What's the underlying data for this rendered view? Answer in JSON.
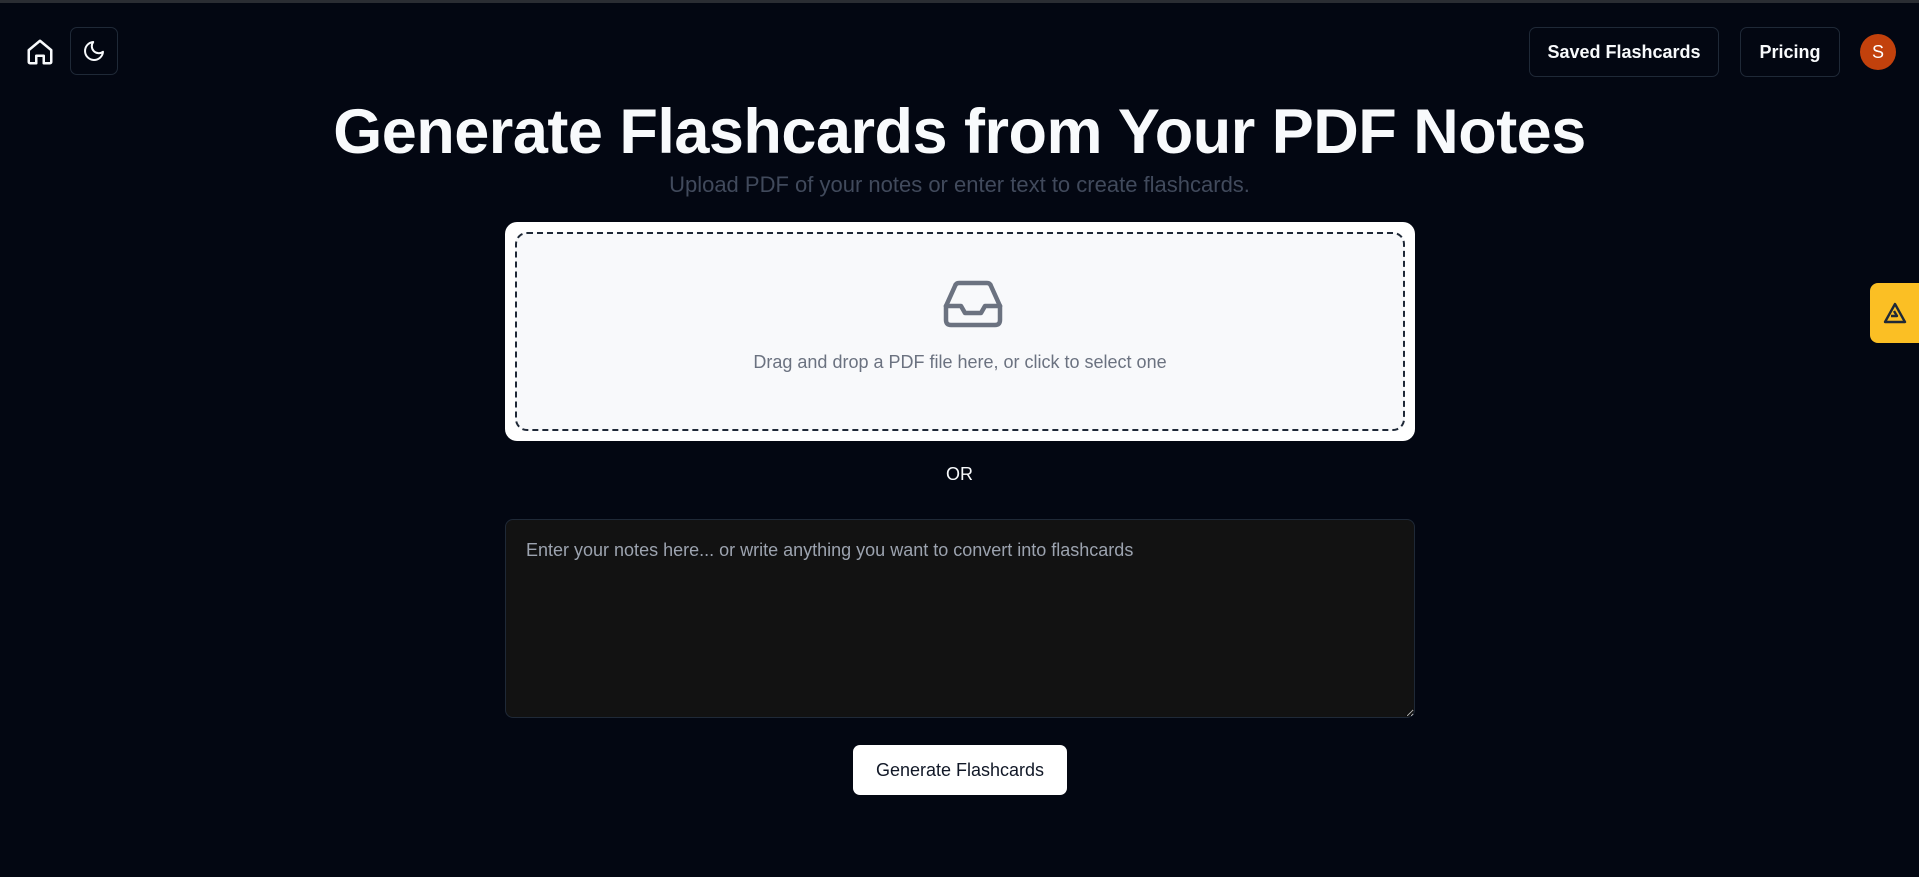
{
  "navbar": {
    "home_icon": "home-icon",
    "theme_icon": "moon-icon",
    "saved_label": "Saved Flashcards",
    "pricing_label": "Pricing",
    "avatar_initial": "S",
    "avatar_color": "#c2410c"
  },
  "hero": {
    "title": "Generate Flashcards from Your PDF Notes",
    "subtitle": "Upload PDF of your notes or enter text to create flashcards."
  },
  "dropzone": {
    "icon": "inbox-icon",
    "text": "Drag and drop a PDF file here, or click to select one"
  },
  "divider": {
    "label": "OR"
  },
  "notes": {
    "value": "",
    "placeholder": "Enter your notes here... or write anything you want to convert into flashcards"
  },
  "actions": {
    "generate_label": "Generate Flashcards"
  },
  "side_widget": {
    "icon": "triangle-logo-icon",
    "color": "#fbbf24"
  },
  "colors": {
    "background": "#030712",
    "accent_text": "#f8fafc"
  }
}
